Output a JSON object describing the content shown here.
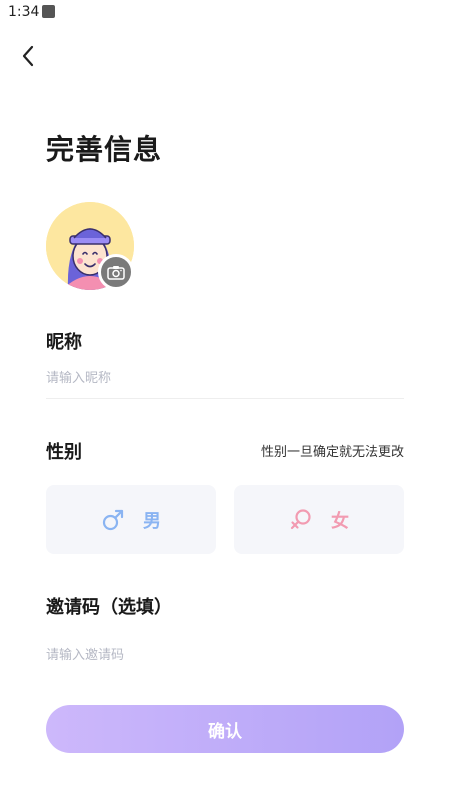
{
  "status_bar": {
    "time": "1:34"
  },
  "header": {
    "title": "完善信息"
  },
  "nickname": {
    "label": "昵称",
    "placeholder": "请输入昵称"
  },
  "gender": {
    "label": "性别",
    "note": "性别一旦确定就无法更改",
    "options": [
      {
        "label": "男",
        "icon": "male-symbol-icon",
        "color": "#8ab4f2"
      },
      {
        "label": "女",
        "icon": "female-symbol-icon",
        "color": "#f29bb1"
      }
    ]
  },
  "invite": {
    "label": "邀请码（选填）",
    "placeholder": "请输入邀请码"
  },
  "confirm": {
    "label": "确认"
  },
  "colors": {
    "accent_start": "#cdb8fb",
    "accent_end": "#b2a2f7",
    "avatar_bg": "#fde7a0"
  }
}
